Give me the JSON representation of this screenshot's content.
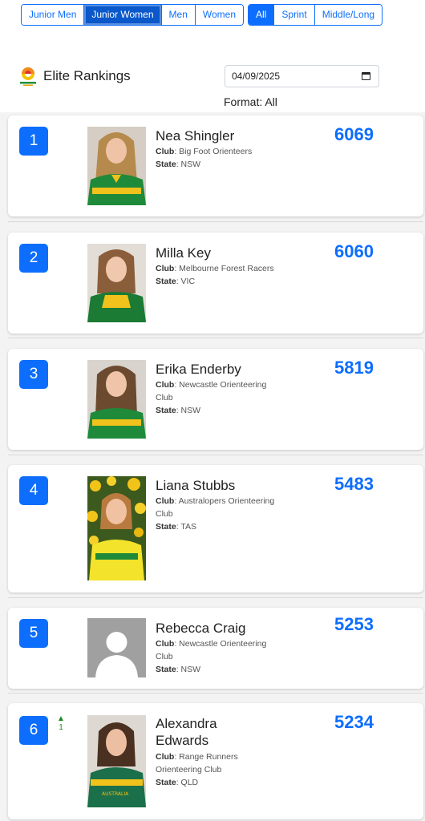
{
  "filters": {
    "category": [
      "Junior Men",
      "Junior Women",
      "Men",
      "Women"
    ],
    "format": [
      "All",
      "Sprint",
      "Middle/Long"
    ]
  },
  "header": {
    "title": "Elite Rankings",
    "date": "04/09/2025",
    "format_label": "Format: All"
  },
  "club_label": "Club",
  "state_label": "State",
  "athletes": [
    {
      "rank": "1",
      "name": "Nea Shingler",
      "club": "Big Foot Orienteers",
      "state": "NSW",
      "score": "6069"
    },
    {
      "rank": "2",
      "name": "Milla Key",
      "club": "Melbourne Forest Racers",
      "state": "VIC",
      "score": "6060"
    },
    {
      "rank": "3",
      "name": "Erika Enderby",
      "club": "Newcastle Orienteering Club",
      "state": "NSW",
      "score": "5819"
    },
    {
      "rank": "4",
      "name": "Liana Stubbs",
      "club": "Australopers Orienteering Club",
      "state": "TAS",
      "score": "5483"
    },
    {
      "rank": "5",
      "name": "Rebecca Craig",
      "club": "Newcastle Orienteering Club",
      "state": "NSW",
      "score": "5253"
    },
    {
      "rank": "6",
      "name": "Alexandra Edwards",
      "club": "Range Runners Orienteering Club",
      "state": "QLD",
      "score": "5234",
      "change": "1"
    }
  ],
  "colors": {
    "accent": "#0d6efd",
    "up": "#1a8a1a"
  }
}
